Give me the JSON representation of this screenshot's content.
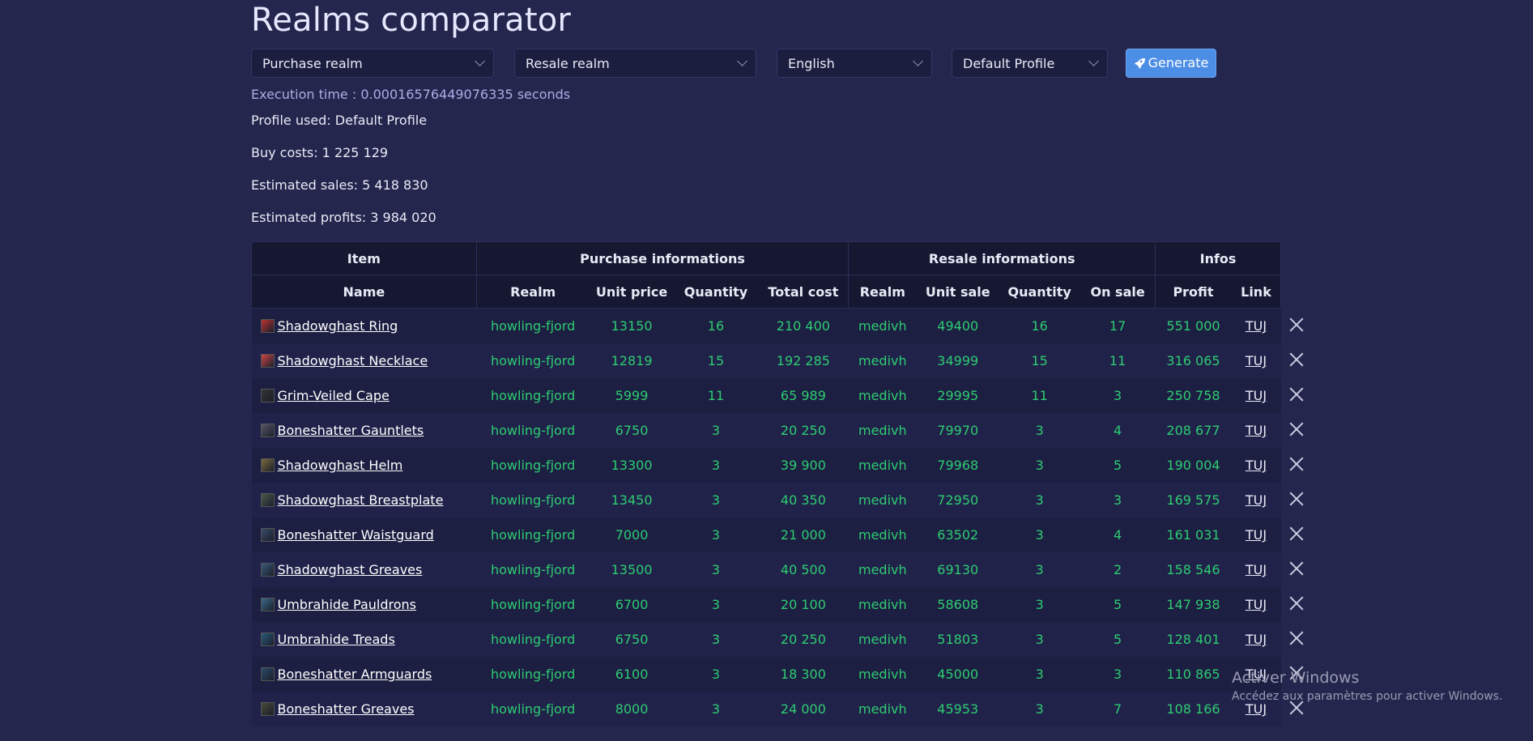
{
  "page": {
    "title": "Realms comparator"
  },
  "controls": {
    "purchase_realm": "Purchase realm",
    "resale_realm": "Resale realm",
    "language": "English",
    "profile": "Default Profile",
    "generate": "Generate"
  },
  "execution_time": "Execution time : 0.00016576449076335 seconds",
  "summary": {
    "profile_used": "Profile used: Default Profile",
    "buy_costs": "Buy costs: 1 225 129",
    "estimated_sales": "Estimated sales: 5 418 830",
    "estimated_profits": "Estimated profits: 3 984 020"
  },
  "table": {
    "groups": [
      "Item",
      "Purchase informations",
      "Resale informations",
      "Infos"
    ],
    "columns": [
      "Name",
      "Realm",
      "Unit price",
      "Quantity",
      "Total cost",
      "Realm",
      "Unit sale",
      "Quantity",
      "On sale",
      "Profit",
      "Link"
    ],
    "rows": [
      {
        "name": "Shadowghast Ring",
        "p_realm": "howling-fjord",
        "unit_price": "13150",
        "p_qty": "16",
        "total": "210 400",
        "r_realm": "medivh",
        "unit_sale": "49400",
        "r_qty": "16",
        "on_sale": "17",
        "profit": "551 000",
        "link": "TUJ",
        "icon": "ring-icon"
      },
      {
        "name": "Shadowghast Necklace",
        "p_realm": "howling-fjord",
        "unit_price": "12819",
        "p_qty": "15",
        "total": "192 285",
        "r_realm": "medivh",
        "unit_sale": "34999",
        "r_qty": "15",
        "on_sale": "11",
        "profit": "316 065",
        "link": "TUJ",
        "icon": "necklace-icon"
      },
      {
        "name": "Grim-Veiled Cape",
        "p_realm": "howling-fjord",
        "unit_price": "5999",
        "p_qty": "11",
        "total": "65 989",
        "r_realm": "medivh",
        "unit_sale": "29995",
        "r_qty": "11",
        "on_sale": "3",
        "profit": "250 758",
        "link": "TUJ",
        "icon": "cape-icon"
      },
      {
        "name": "Boneshatter Gauntlets",
        "p_realm": "howling-fjord",
        "unit_price": "6750",
        "p_qty": "3",
        "total": "20 250",
        "r_realm": "medivh",
        "unit_sale": "79970",
        "r_qty": "3",
        "on_sale": "4",
        "profit": "208 677",
        "link": "TUJ",
        "icon": "gauntlets-icon"
      },
      {
        "name": "Shadowghast Helm",
        "p_realm": "howling-fjord",
        "unit_price": "13300",
        "p_qty": "3",
        "total": "39 900",
        "r_realm": "medivh",
        "unit_sale": "79968",
        "r_qty": "3",
        "on_sale": "5",
        "profit": "190 004",
        "link": "TUJ",
        "icon": "helm-icon"
      },
      {
        "name": "Shadowghast Breastplate",
        "p_realm": "howling-fjord",
        "unit_price": "13450",
        "p_qty": "3",
        "total": "40 350",
        "r_realm": "medivh",
        "unit_sale": "72950",
        "r_qty": "3",
        "on_sale": "3",
        "profit": "169 575",
        "link": "TUJ",
        "icon": "breastplate-icon"
      },
      {
        "name": "Boneshatter Waistguard",
        "p_realm": "howling-fjord",
        "unit_price": "7000",
        "p_qty": "3",
        "total": "21 000",
        "r_realm": "medivh",
        "unit_sale": "63502",
        "r_qty": "3",
        "on_sale": "4",
        "profit": "161 031",
        "link": "TUJ",
        "icon": "waistguard-icon"
      },
      {
        "name": "Shadowghast Greaves",
        "p_realm": "howling-fjord",
        "unit_price": "13500",
        "p_qty": "3",
        "total": "40 500",
        "r_realm": "medivh",
        "unit_sale": "69130",
        "r_qty": "3",
        "on_sale": "2",
        "profit": "158 546",
        "link": "TUJ",
        "icon": "greaves-icon"
      },
      {
        "name": "Umbrahide Pauldrons",
        "p_realm": "howling-fjord",
        "unit_price": "6700",
        "p_qty": "3",
        "total": "20 100",
        "r_realm": "medivh",
        "unit_sale": "58608",
        "r_qty": "3",
        "on_sale": "5",
        "profit": "147 938",
        "link": "TUJ",
        "icon": "pauldrons-icon"
      },
      {
        "name": "Umbrahide Treads",
        "p_realm": "howling-fjord",
        "unit_price": "6750",
        "p_qty": "3",
        "total": "20 250",
        "r_realm": "medivh",
        "unit_sale": "51803",
        "r_qty": "3",
        "on_sale": "5",
        "profit": "128 401",
        "link": "TUJ",
        "icon": "treads-icon"
      },
      {
        "name": "Boneshatter Armguards",
        "p_realm": "howling-fjord",
        "unit_price": "6100",
        "p_qty": "3",
        "total": "18 300",
        "r_realm": "medivh",
        "unit_sale": "45000",
        "r_qty": "3",
        "on_sale": "3",
        "profit": "110 865",
        "link": "TUJ",
        "icon": "armguards-icon"
      },
      {
        "name": "Boneshatter Greaves",
        "p_realm": "howling-fjord",
        "unit_price": "8000",
        "p_qty": "3",
        "total": "24 000",
        "r_realm": "medivh",
        "unit_sale": "45953",
        "r_qty": "3",
        "on_sale": "7",
        "profit": "108 166",
        "link": "TUJ",
        "icon": "greaves-icon"
      }
    ]
  },
  "watermark": {
    "line1": "Activer Windows",
    "line2": "Accédez aux paramètres pour activer Windows."
  }
}
